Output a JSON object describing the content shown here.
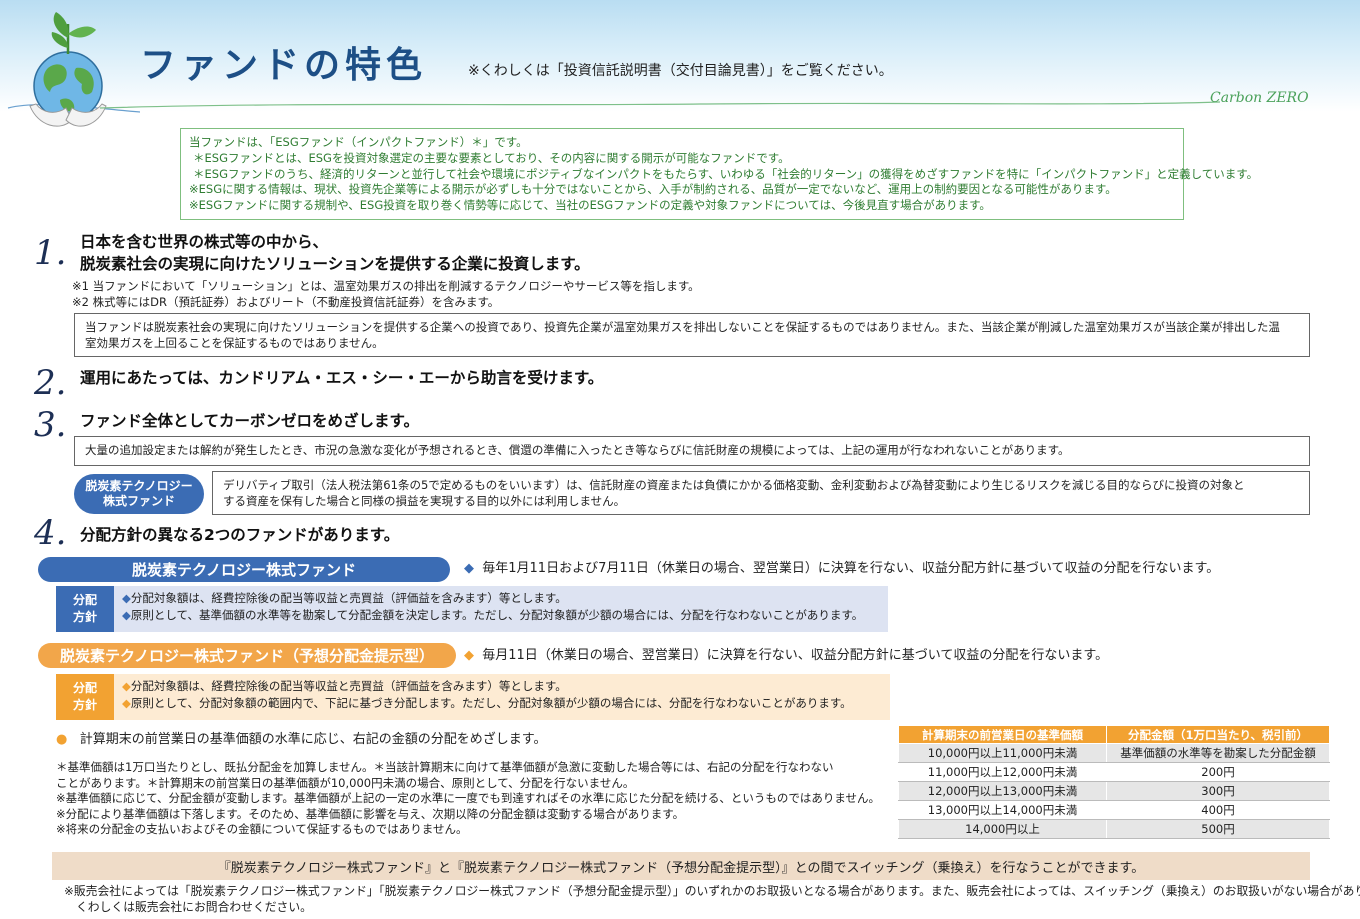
{
  "header": {
    "title": "ファンドの特色",
    "note": "※くわしくは「投資信託説明書（交付目論見書）」をご覧ください。",
    "brand": "Carbon ZERO"
  },
  "esg_box": {
    "lines": [
      "当ファンドは、「ESGファンド（インパクトファンド）＊」です。",
      "＊ESGファンドとは、ESGを投資対象選定の主要な要素としており、その内容に関する開示が可能なファンドです。",
      "＊ESGファンドのうち、経済的リターンと並行して社会や環境にポジティブなインパクトをもたらす、いわゆる「社会的リターン」の獲得をめざすファンドを特に「インパクトファンド」と定義しています。",
      "※ESGに関する情報は、現状、投資先企業等による開示が必ずしも十分ではないことから、入手が制約される、品質が一定でないなど、運用上の制約要因となる可能性があります。",
      "※ESGファンドに関する規制や、ESG投資を取り巻く情勢等に応じて、当社のESGファンドの定義や対象ファンドについては、今後見直す場合があります。"
    ]
  },
  "section1": {
    "num": "1.",
    "line1": "日本を含む世界の株式等の中から、",
    "line2": "脱炭素社会の実現に向けたソリューションを提供する企業に投資します。",
    "note1": "※1 当ファンドにおいて「ソリューション」とは、温室効果ガスの排出を削減するテクノロジーやサービス等を指します。",
    "note2": "※2 株式等にはDR（預託証券）およびリート（不動産投資信託証券）を含みます。",
    "box_line1": "当ファンドは脱炭素社会の実現に向けたソリューションを提供する企業への投資であり、投資先企業が温室効果ガスを排出しないことを保証するものではありません。また、当該企業が削減した温室効果ガスが当該企業が排出した温",
    "box_line2": "室効果ガスを上回ることを保証するものではありません。"
  },
  "section2": {
    "num": "2.",
    "heading": "運用にあたっては、カンドリアム・エス・シー・エーから助言を受けます。"
  },
  "section3": {
    "num": "3.",
    "heading": "ファンド全体としてカーボンゼロをめざします。",
    "box": "大量の追加設定または解約が発生したとき、市況の急激な変化が予想されるとき、償還の準備に入ったとき等ならびに信託財産の規模によっては、上記の運用が行なわれないことがあります。",
    "tag_line1": "脱炭素テクノロジー",
    "tag_line2": "株式ファンド",
    "deriv_line1": "デリバティブ取引（法人税法第61条の5で定めるものをいいます）は、信託財産の資産または負債にかかる価格変動、金利変動および為替変動により生じるリスクを減じる目的ならびに投資の対象と",
    "deriv_line2": "する資産を保有した場合と同様の損益を実現する目的以外には利用しません。"
  },
  "section4": {
    "num": "4.",
    "heading": "分配方針の異なる2つのファンドがあります。",
    "fund_a": {
      "name": "脱炭素テクノロジー株式ファンド",
      "desc": "毎年1月11日および7月11日（休業日の場合、翌営業日）に決算を行ない、収益分配方針に基づいて収益の分配を行ないます。",
      "label1": "分配",
      "label2": "方針",
      "line1": "分配対象額は、経費控除後の配当等収益と売買益（評価益を含みます）等とします。",
      "line2": "原則として、基準価額の水準等を勘案して分配金額を決定します。ただし、分配対象額が少額の場合には、分配を行なわないことがあります。"
    },
    "fund_b": {
      "name": "脱炭素テクノロジー株式ファンド（予想分配金提示型）",
      "desc": "毎月11日（休業日の場合、翌営業日）に決算を行ない、収益分配方針に基づいて収益の分配を行ないます。",
      "label1": "分配",
      "label2": "方針",
      "line1": "分配対象額は、経費控除後の配当等収益と売買益（評価益を含みます）等とします。",
      "line2": "原則として、分配対象額の範囲内で、下記に基づき分配します。ただし、分配対象額が少額の場合には、分配を行なわないことがあります。"
    },
    "bullet": "計算期末の前営業日の基準価額の水準に応じ、右記の金額の分配をめざします。",
    "notes": [
      "＊基準価額は1万口当たりとし、既払分配金を加算しません。＊当該計算期末に向けて基準価額が急激に変動した場合等には、右記の分配を行なわない",
      "ことがあります。＊計算期末の前営業日の基準価額が10,000円未満の場合、原則として、分配を行ないません。",
      "※基準価額に応じて、分配金額が変動します。基準価額が上記の一定の水準に一度でも到達すればその水準に応じた分配を続ける、というものではありません。",
      "※分配により基準価額は下落します。そのため、基準価額に影響を与え、次期以降の分配金額は変動する場合があります。",
      "※将来の分配金の支払いおよびその金額について保証するものではありません。"
    ]
  },
  "dist_table": {
    "headers": [
      "計算期末の前営業日の基準価額",
      "分配金額（1万口当たり、税引前）"
    ],
    "rows": [
      [
        "10,000円以上11,000円未満",
        "基準価額の水準等を勘案した分配金額"
      ],
      [
        "11,000円以上12,000円未満",
        "200円"
      ],
      [
        "12,000円以上13,000円未満",
        "300円"
      ],
      [
        "13,000円以上14,000円未満",
        "400円"
      ],
      [
        "14,000円以上",
        "500円"
      ]
    ]
  },
  "switching": "『脱炭素テクノロジー株式ファンド』と『脱炭素テクノロジー株式ファンド（予想分配金提示型）』との間でスイッチング（乗換え）を行なうことができます。",
  "footer": {
    "line1": "※販売会社によっては「脱炭素テクノロジー株式ファンド」「脱炭素テクノロジー株式ファンド（予想分配金提示型）」のいずれかのお取扱いとなる場合があります。また、販売会社によっては、スイッチング（乗換え）のお取扱いがない場合があります。",
    "line2": "くわしくは販売会社にお問合わせください。"
  },
  "colors": {
    "title_blue": "#1d4f86",
    "esg_green": "#2f7d32",
    "fund_blue": "#3b6cb4",
    "fund_orange": "#f2a64a",
    "switch_bg": "#efdcc8"
  },
  "icons": [
    "globe-plant-icon",
    "diamond-bullet-icon",
    "orange-dot-icon"
  ]
}
